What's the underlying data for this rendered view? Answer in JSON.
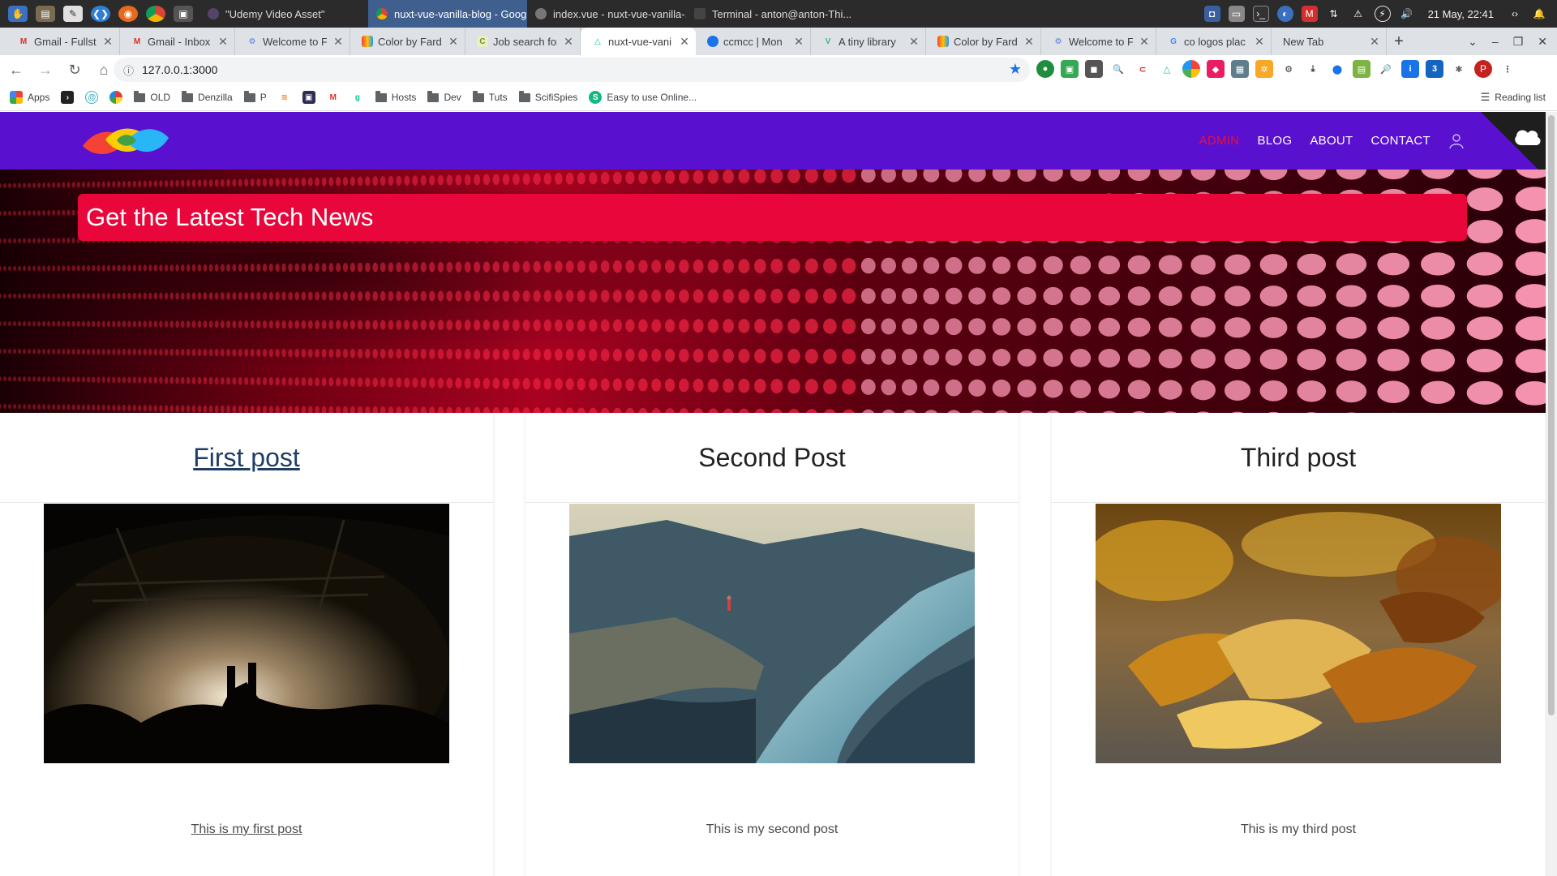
{
  "os_panel": {
    "tasks": [
      {
        "label": "\"Udemy Video Asset\"",
        "active": false
      },
      {
        "label": "nuxt-vue-vanilla-blog - Goog...",
        "active": true
      },
      {
        "label": "index.vue - nuxt-vue-vanilla-...",
        "active": false
      },
      {
        "label": "Terminal - anton@anton-Thi...",
        "active": false
      }
    ],
    "clock": "21 May, 22:41"
  },
  "browser": {
    "tabs": [
      {
        "label": "Gmail - Fullsta",
        "favicon": "gmail-icon",
        "active": false
      },
      {
        "label": "Gmail - Inbox",
        "favicon": "gmail-icon",
        "active": false
      },
      {
        "label": "Welcome to F",
        "favicon": "hostinger-icon",
        "active": false
      },
      {
        "label": "Color by Fard",
        "favicon": "color-icon",
        "active": false
      },
      {
        "label": "Job search for",
        "favicon": "job-icon",
        "active": false
      },
      {
        "label": "nuxt-vue-vani",
        "favicon": "nuxt-icon",
        "active": true
      },
      {
        "label": "ccmcc | Mon",
        "favicon": "globe-icon",
        "active": false
      },
      {
        "label": "A tiny library",
        "favicon": "vue-icon",
        "active": false
      },
      {
        "label": "Color by Fard",
        "favicon": "color-icon",
        "active": false
      },
      {
        "label": "Welcome to F",
        "favicon": "hostinger-icon",
        "active": false
      },
      {
        "label": "co logos plac",
        "favicon": "google-icon",
        "active": false
      },
      {
        "label": "New Tab",
        "favicon": "",
        "active": false
      }
    ],
    "url": "127.0.0.1:3000",
    "bookmarks": [
      {
        "label": "Apps",
        "icon": "apps-grid-icon"
      },
      {
        "label": "",
        "icon": "prompt-icon"
      },
      {
        "label": "",
        "icon": "swirl-icon"
      },
      {
        "label": "",
        "icon": "dots-icon"
      },
      {
        "label": "OLD",
        "icon": "folder-icon"
      },
      {
        "label": "Denzilla",
        "icon": "folder-icon"
      },
      {
        "label": "P",
        "icon": "folder-icon"
      },
      {
        "label": "",
        "icon": "stack-icon"
      },
      {
        "label": "",
        "icon": "badge-icon"
      },
      {
        "label": "",
        "icon": "gmail-icon"
      },
      {
        "label": "",
        "icon": "g-icon"
      },
      {
        "label": "Hosts",
        "icon": "folder-icon"
      },
      {
        "label": "Dev",
        "icon": "folder-icon"
      },
      {
        "label": "Tuts",
        "icon": "folder-icon"
      },
      {
        "label": "ScifiSpies",
        "icon": "folder-icon"
      },
      {
        "label": "Easy to use Online...",
        "icon": "s-green-icon"
      }
    ],
    "reading_list": "Reading list"
  },
  "site": {
    "nav": {
      "admin": "ADMIN",
      "blog": "BLOG",
      "about": "ABOUT",
      "contact": "CONTACT"
    },
    "hero_title": "Get the Latest Tech News",
    "posts": [
      {
        "title": "First post",
        "excerpt": "This is my first post",
        "image": "concert-photo"
      },
      {
        "title": "Second Post",
        "excerpt": "This is my second post",
        "image": "fjord-cliff-photo"
      },
      {
        "title": "Third post",
        "excerpt": "This is my third post",
        "image": "autumn-leaves-photo"
      }
    ]
  },
  "colors": {
    "nav_bg": "#5a10cf",
    "accent_red": "#e8063a",
    "admin_link": "#e8103a"
  }
}
